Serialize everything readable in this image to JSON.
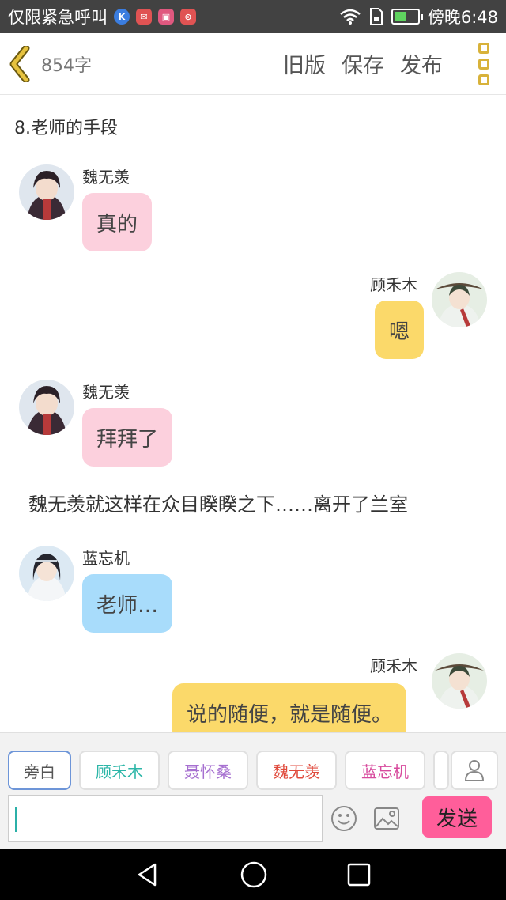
{
  "status_bar": {
    "left_text": "仅限紧急呼叫",
    "time": "傍晚6:48",
    "app_icons": [
      {
        "icon": "k-app-icon",
        "glyph": "K",
        "color": "#3b7de0"
      },
      {
        "icon": "mail-app-icon",
        "glyph": "✉",
        "color": "#e05353"
      },
      {
        "icon": "gallery-app-icon",
        "glyph": "▣",
        "color": "#e0587f"
      },
      {
        "icon": "compass-app-icon",
        "glyph": "⊙",
        "color": "#e05353"
      }
    ],
    "battery_level": 0.55
  },
  "header": {
    "word_count": "854字",
    "actions": [
      "旧版",
      "保存",
      "发布"
    ]
  },
  "chapter_title": "8.老师的手段",
  "messages": [
    {
      "speaker": "魏无羡",
      "text": "真的",
      "side": "left",
      "style": "pink"
    },
    {
      "speaker": "顾禾木",
      "text": "嗯",
      "side": "right",
      "style": "yellow"
    },
    {
      "speaker": "魏无羡",
      "text": "拜拜了",
      "side": "left",
      "style": "pink"
    },
    {
      "narration": "魏无羡就这样在众目睽睽之下……离开了兰室"
    },
    {
      "speaker": "蓝忘机",
      "text": "老师…",
      "side": "left",
      "style": "blue"
    },
    {
      "speaker": "顾禾木",
      "text": "说的随便，就是随便。",
      "side": "right",
      "style": "yellow"
    }
  ],
  "role_chips": [
    {
      "label": "旁白",
      "color": "#555555"
    },
    {
      "label": "顾禾木",
      "color": "#2db6a8"
    },
    {
      "label": "聂怀桑",
      "color": "#a66fd0"
    },
    {
      "label": "魏无羡",
      "color": "#e04a3c"
    },
    {
      "label": "蓝忘机",
      "color": "#d74a9d"
    }
  ],
  "composer": {
    "input_value": "",
    "send_label": "发送"
  },
  "colors": {
    "accent_yellow": "#d8b23a",
    "send_pink": "#ff5e9a",
    "bubble_pink": "#fcd0dd",
    "bubble_yellow": "#fbd96a",
    "bubble_blue": "#a8dcfb"
  }
}
